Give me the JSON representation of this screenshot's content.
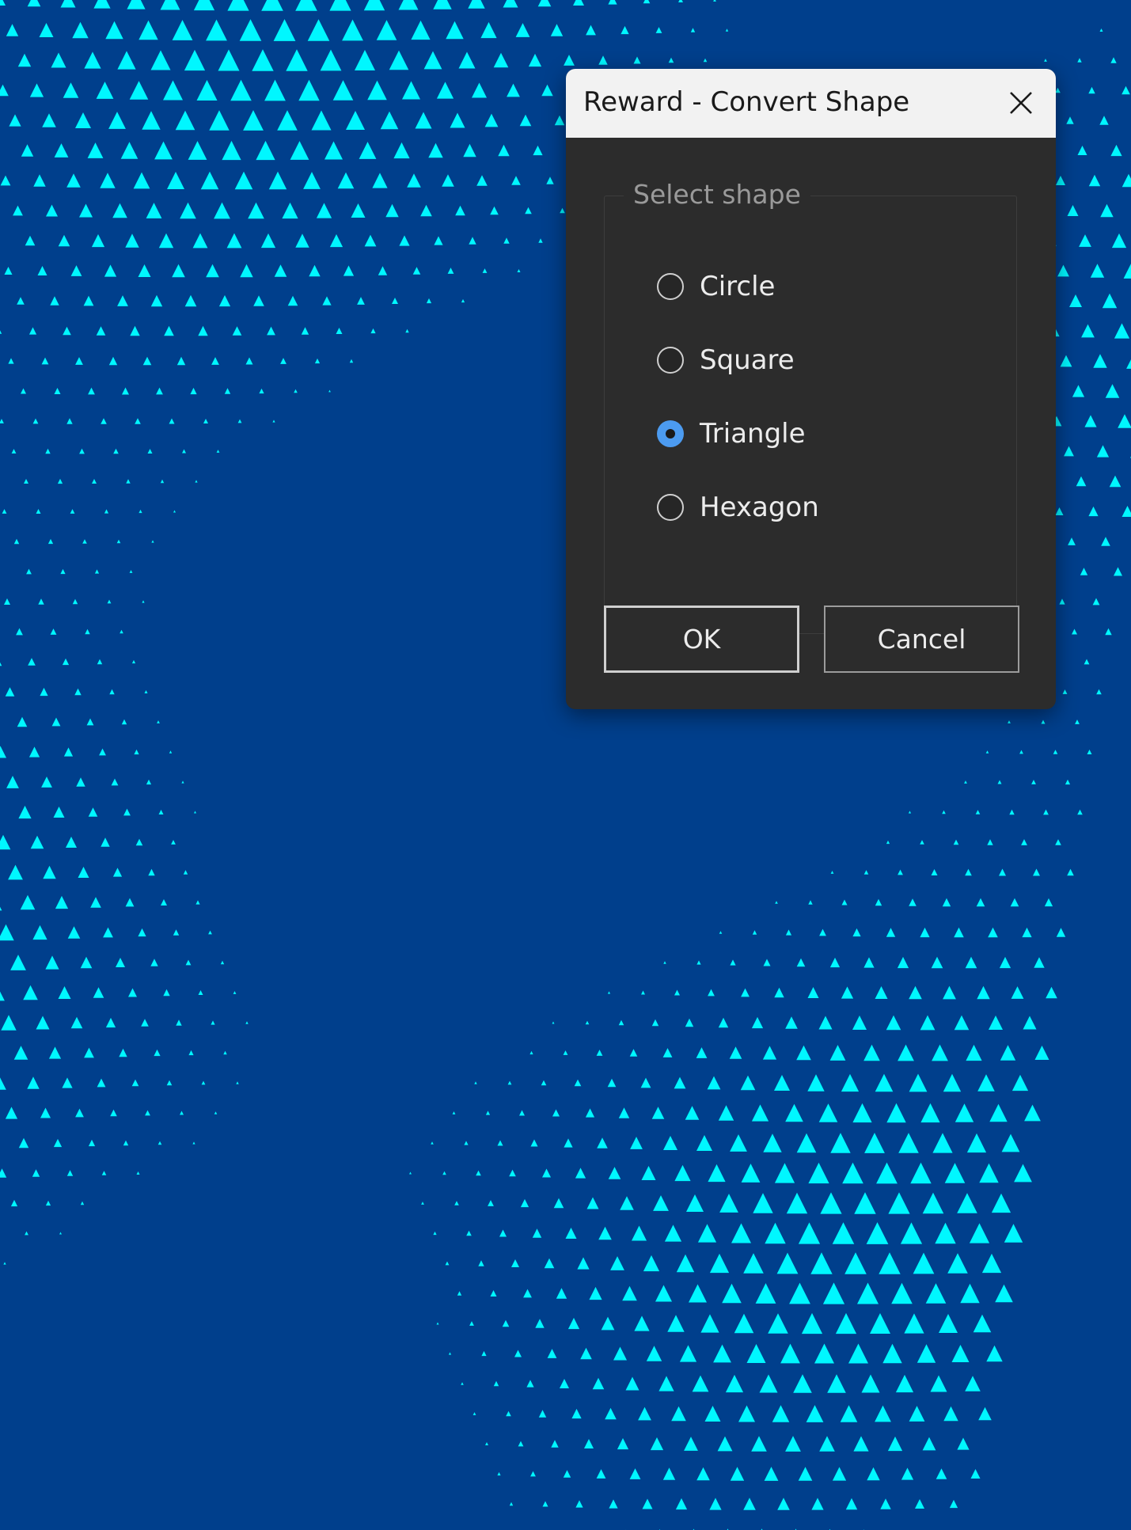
{
  "dialog": {
    "title": "Reward - Convert Shape",
    "close_icon": "close-icon",
    "group_label": "Select shape",
    "options": [
      {
        "label": "Circle",
        "checked": false
      },
      {
        "label": "Square",
        "checked": false
      },
      {
        "label": "Triangle",
        "checked": true
      },
      {
        "label": "Hexagon",
        "checked": false
      }
    ],
    "ok_label": "OK",
    "cancel_label": "Cancel"
  },
  "colors": {
    "background": "#003f8c",
    "pattern": "#00f7ff",
    "dialog_body": "#2c2c2c",
    "titlebar": "#f2f2f2",
    "radio_selected": "#4c9bf0"
  },
  "background_pattern": {
    "shape": "triangle"
  }
}
